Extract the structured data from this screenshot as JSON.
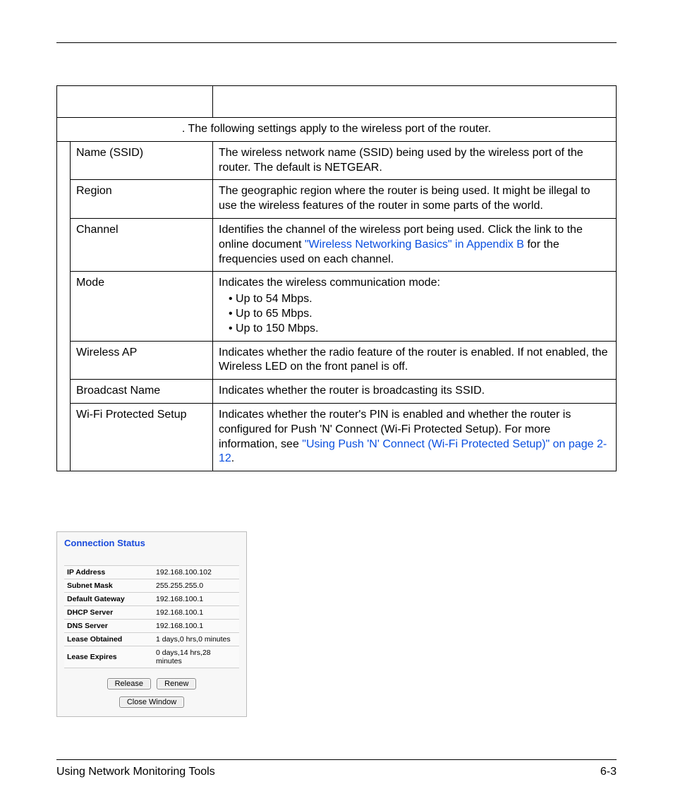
{
  "table": {
    "spanText": ". The following settings apply to the wireless port of the router.",
    "rows": [
      {
        "label": "Name (SSID)",
        "desc": "The wireless network name (SSID) being used by the wireless port of the router. The default is NETGEAR."
      },
      {
        "label": "Region",
        "desc": "The geographic region where the router is being used. It might be illegal to use the wireless features of the router in some parts of the world."
      },
      {
        "label": "Channel",
        "descPre": "Identifies the channel of the wireless port being used. Click the link to the online document ",
        "link": "\"Wireless Networking Basics\" in Appendix B",
        "descPost": " for the frequencies used on each channel."
      },
      {
        "label": "Mode",
        "descIntro": "Indicates the wireless communication mode:",
        "bullets": [
          "Up to 54 Mbps.",
          "Up to 65 Mbps.",
          "Up to 150 Mbps."
        ]
      },
      {
        "label": "Wireless AP",
        "desc": "Indicates whether the radio feature of the router is enabled. If not enabled, the Wireless LED on the front panel is off."
      },
      {
        "label": "Broadcast Name",
        "desc": "Indicates whether the router is broadcasting its SSID."
      },
      {
        "label": "Wi-Fi Protected Setup",
        "descPre": "Indicates whether the router's PIN is enabled and whether the router is configured for Push 'N' Connect (Wi-Fi Protected Setup). For more information, see ",
        "link": "\"Using Push 'N' Connect (Wi-Fi Protected Setup)\" on page 2-12",
        "descPost": "."
      }
    ]
  },
  "panel": {
    "title": "Connection Status",
    "rows": [
      {
        "label": "IP Address",
        "value": "192.168.100.102"
      },
      {
        "label": "Subnet Mask",
        "value": "255.255.255.0"
      },
      {
        "label": "Default Gateway",
        "value": "192.168.100.1"
      },
      {
        "label": "DHCP Server",
        "value": "192.168.100.1"
      },
      {
        "label": "DNS Server",
        "value": "192.168.100.1"
      },
      {
        "label": "Lease Obtained",
        "value": "1 days,0 hrs,0 minutes"
      },
      {
        "label": "Lease Expires",
        "value": "0 days,14 hrs,28 minutes"
      }
    ],
    "buttons": {
      "release": "Release",
      "renew": "Renew",
      "close": "Close Window"
    }
  },
  "footer": {
    "left": "Using Network Monitoring Tools",
    "right": "6-3"
  }
}
